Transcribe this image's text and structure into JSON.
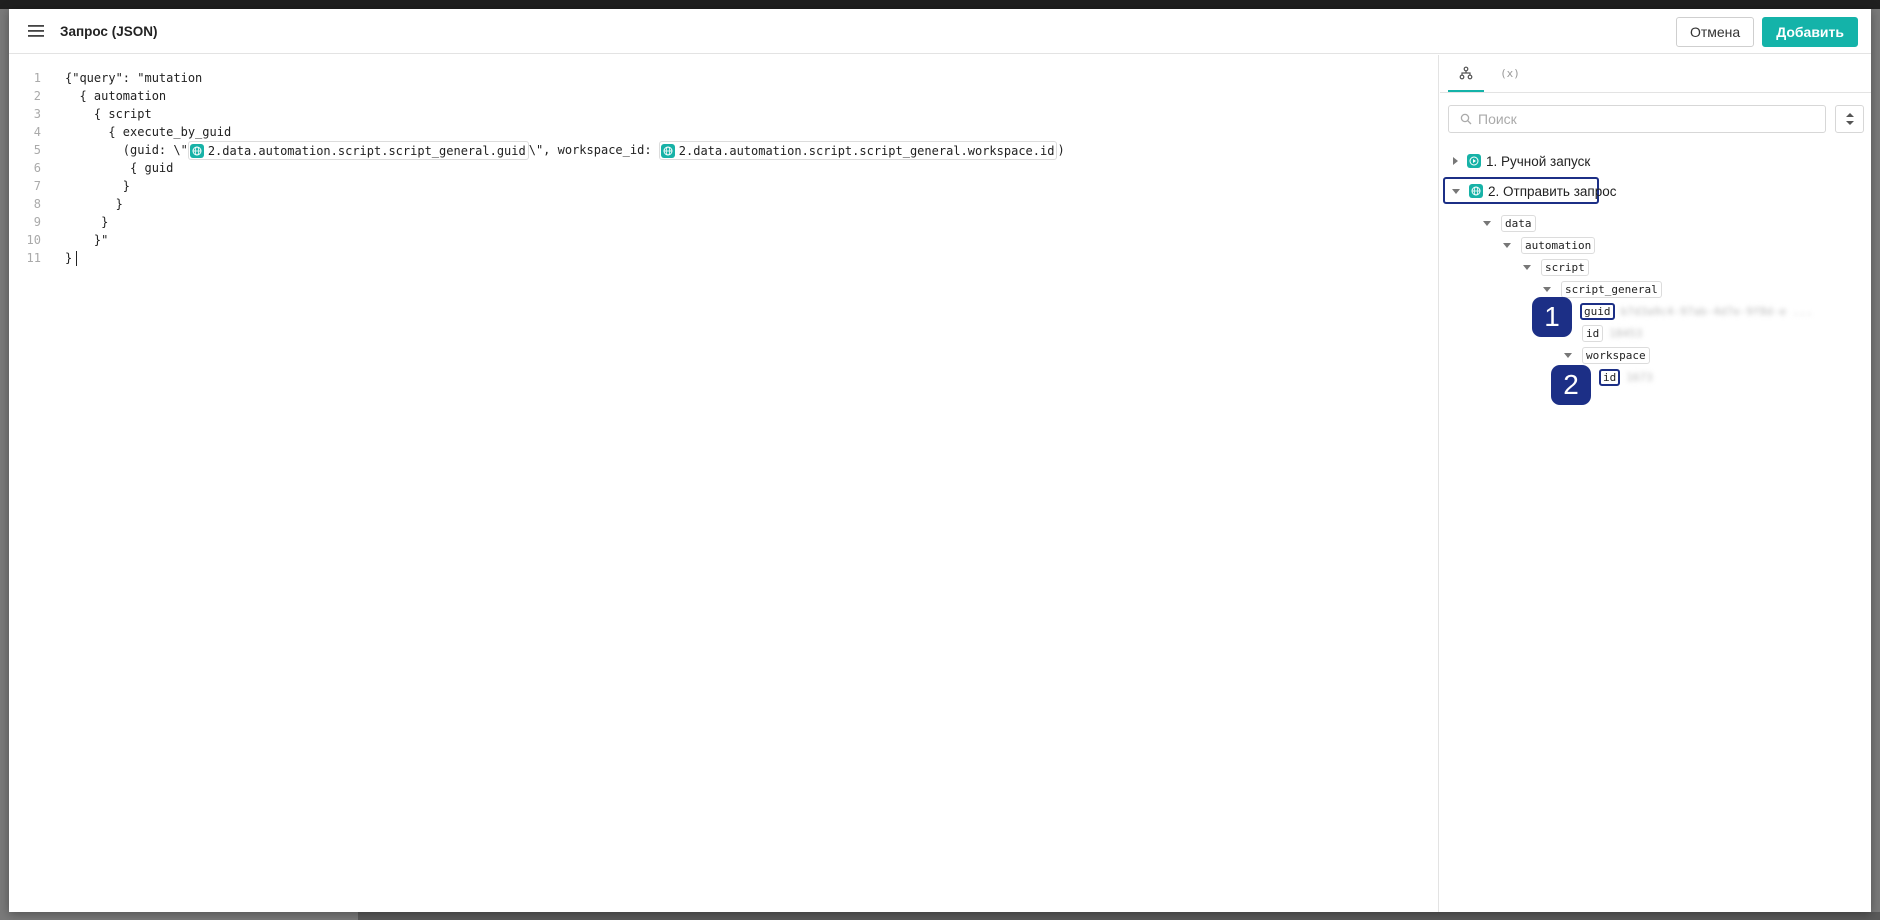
{
  "dialog": {
    "title": "Запрос (JSON)",
    "cancel_label": "Отмена",
    "add_label": "Добавить"
  },
  "editor": {
    "lines": [
      {
        "num": "1",
        "text": "{\"query\": \"mutation"
      },
      {
        "num": "2",
        "text": "  { automation"
      },
      {
        "num": "3",
        "text": "    { script"
      },
      {
        "num": "4",
        "text": "      { execute_by_guid"
      },
      {
        "num": "5",
        "pre": "        (guid: \\\"",
        "chip1": "2.data.automation.script.script_general.guid",
        "mid": "\\\", workspace_id: ",
        "chip2": "2.data.automation.script.script_general.workspace.id",
        "post": ")"
      },
      {
        "num": "6",
        "text": "         { guid"
      },
      {
        "num": "7",
        "text": "        }"
      },
      {
        "num": "8",
        "text": "       }"
      },
      {
        "num": "9",
        "text": "     }"
      },
      {
        "num": "10",
        "text": "    }\""
      },
      {
        "num": "11",
        "text": "}"
      }
    ]
  },
  "panel": {
    "tabs": [
      {
        "name": "tree-tab",
        "icon": "tree-icon"
      },
      {
        "name": "variables-tab",
        "label": "(x)"
      }
    ],
    "search": {
      "placeholder": "Поиск",
      "value": ""
    },
    "steps": [
      {
        "label": "1. Ручной запуск",
        "icon": "play-icon",
        "expanded": false
      },
      {
        "label": "2. Отправить запрос",
        "icon": "globe-icon",
        "expanded": true,
        "highlighted": true
      }
    ],
    "tree": {
      "data": "data",
      "automation": "automation",
      "script": "script",
      "script_general": "script_general",
      "guid": "guid",
      "guid_value": "b7d3a9c4-97ab-4d7e-9f8d-e ...",
      "id": "id",
      "id_value": "18453",
      "workspace": "workspace",
      "workspace_id": "id",
      "workspace_id_value": "1673"
    },
    "markers": [
      "1",
      "2"
    ]
  },
  "colors": {
    "accent": "#14b3a9",
    "highlight": "#1c2f86"
  }
}
